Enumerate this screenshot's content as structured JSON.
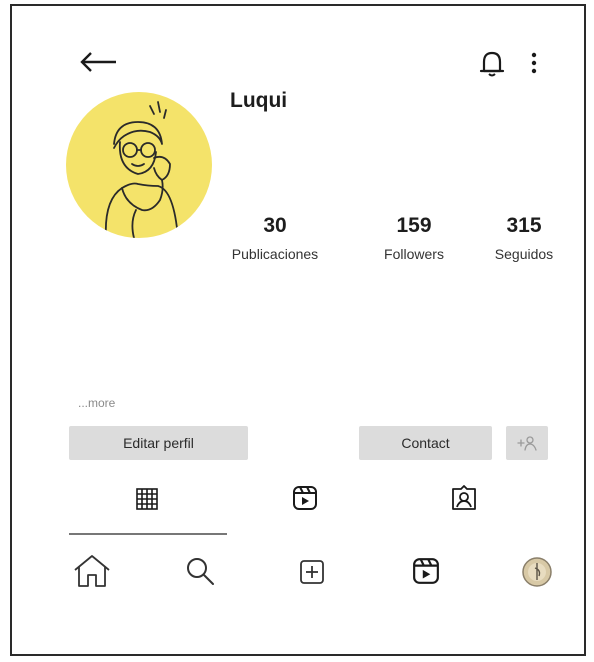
{
  "profile": {
    "username": "Luqui",
    "avatar_color": "#f4e36a"
  },
  "stats": {
    "posts": {
      "value": "30",
      "label": "Publicaciones"
    },
    "followers": {
      "value": "159",
      "label": "Followers"
    },
    "following": {
      "value": "315",
      "label": "Seguidos"
    }
  },
  "bio": {
    "more_label": "...more"
  },
  "actions": {
    "edit_profile_label": "Editar perfil",
    "contact_label": "Contact"
  },
  "icons": {
    "back": "arrow-left-icon",
    "notifications": "bell-icon",
    "menu": "more-vertical-icon",
    "grid": "grid-icon",
    "reels": "reels-icon",
    "tagged": "tagged-icon",
    "home": "home-icon",
    "search": "search-icon",
    "create": "add-post-icon",
    "reels_nav": "reels-icon",
    "profile": "profile-avatar-icon",
    "add_person": "add-person-icon"
  }
}
